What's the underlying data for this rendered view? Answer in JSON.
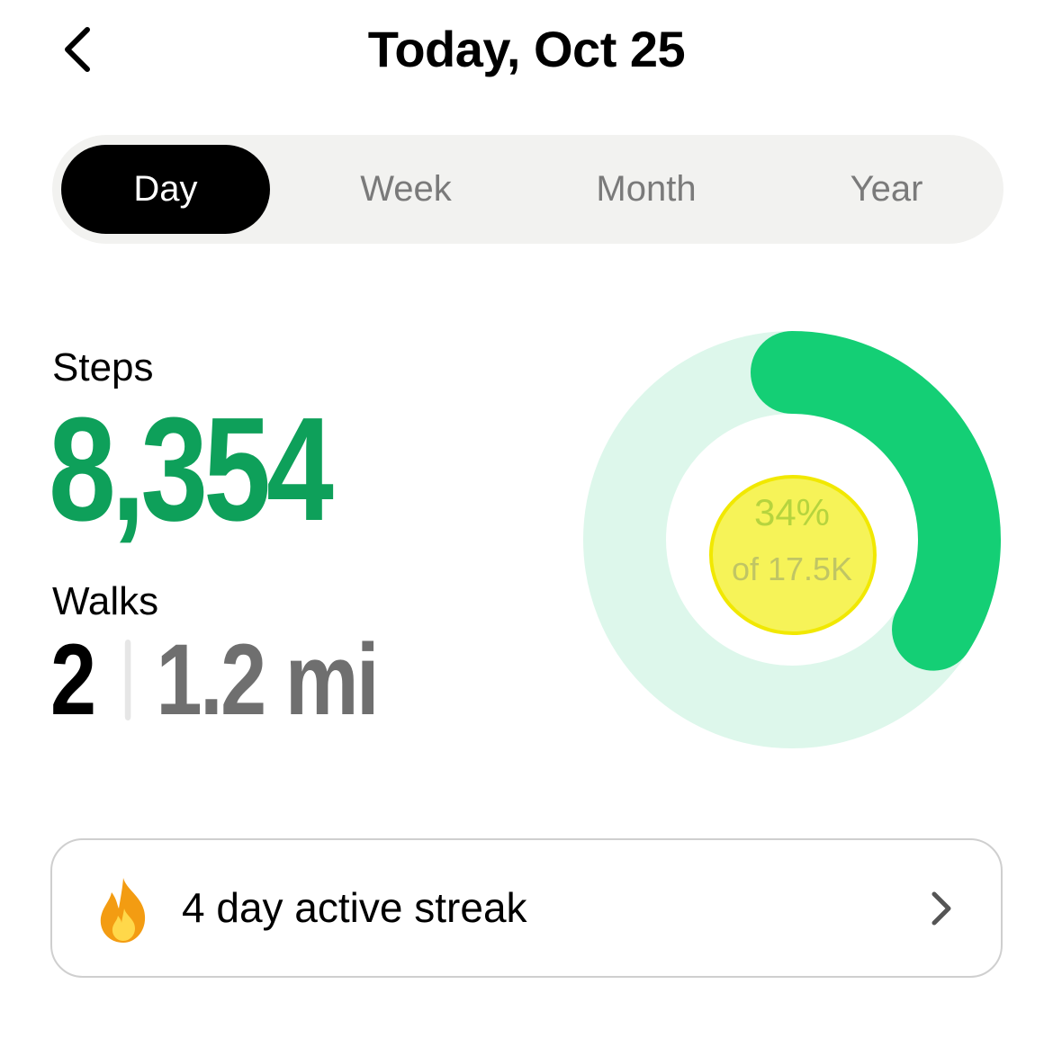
{
  "header": {
    "title": "Today, Oct 25"
  },
  "tabs": [
    {
      "label": "Day",
      "active": true
    },
    {
      "label": "Week",
      "active": false
    },
    {
      "label": "Month",
      "active": false
    },
    {
      "label": "Year",
      "active": false
    }
  ],
  "steps": {
    "label": "Steps",
    "value": "8,354"
  },
  "walks": {
    "label": "Walks",
    "count": "2",
    "distance": "1.2 mi"
  },
  "progress": {
    "percent_text": "34%",
    "goal_text": "of 17.5K",
    "fraction": 0.34
  },
  "streak": {
    "text": "4 day active streak",
    "icon": "fire-icon"
  },
  "colors": {
    "accent_green": "#14cf75",
    "steps_green": "#0ea05a",
    "ring_track": "#ddf7eb",
    "active_tab": "#000000"
  }
}
